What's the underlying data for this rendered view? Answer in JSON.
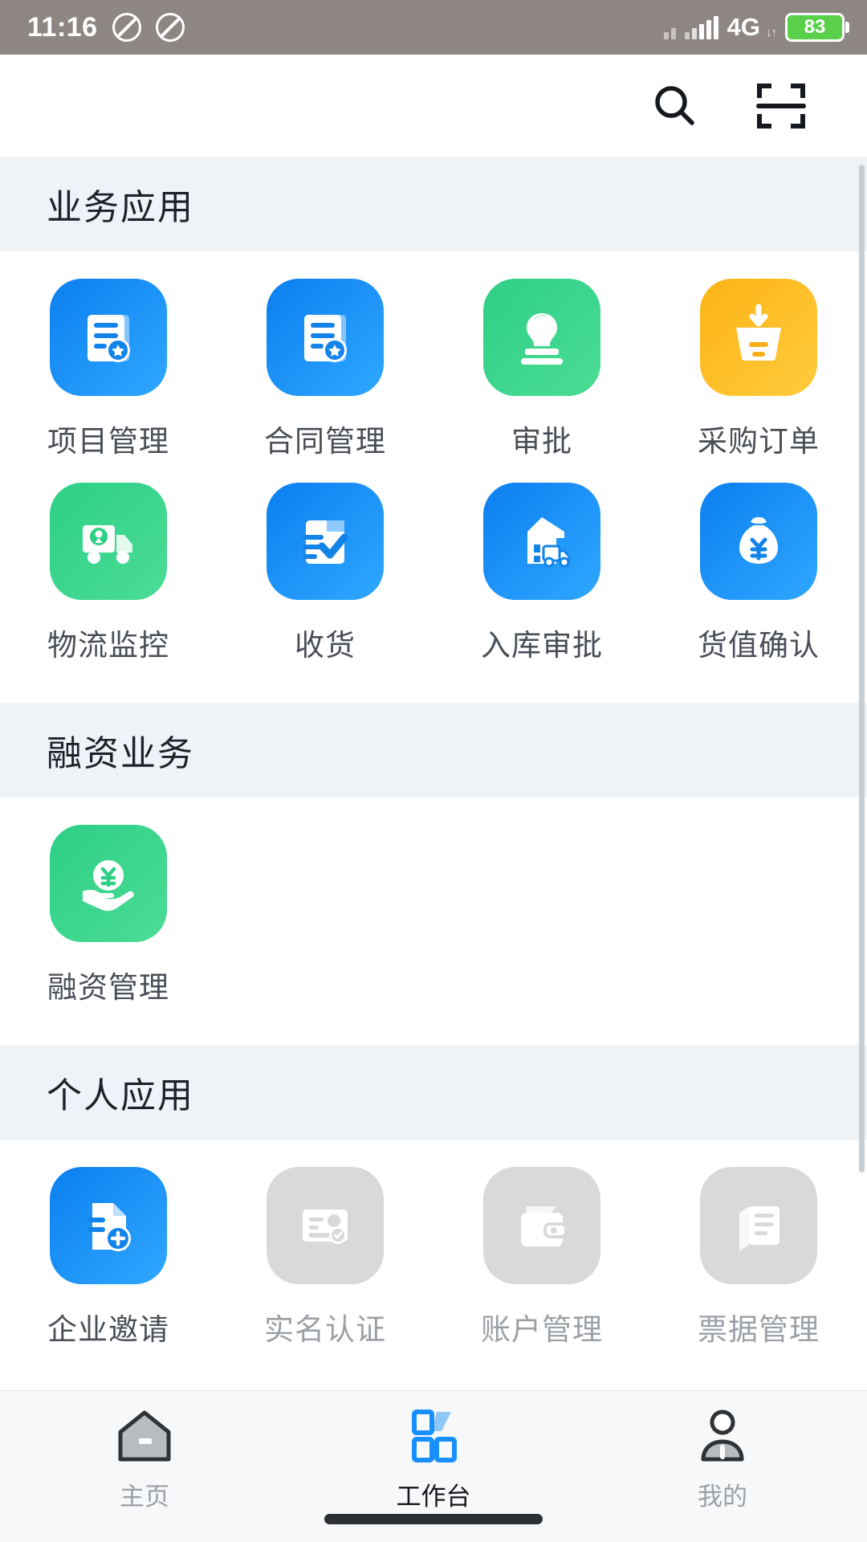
{
  "status_bar": {
    "time": "11:16",
    "network": "4G",
    "network_sub": "↓↑",
    "battery": "83",
    "icons": [
      "mute-icon",
      "mute-icon",
      "signal-bars-icon",
      "battery-icon"
    ]
  },
  "header": {
    "search_icon": "search-icon",
    "scan_icon": "scan-qr-icon"
  },
  "sections": [
    {
      "title": "业务应用",
      "items": [
        {
          "label": "项目管理",
          "icon": "document-star-icon",
          "color": "#1890ff",
          "disabled": false
        },
        {
          "label": "合同管理",
          "icon": "document-star-icon",
          "color": "#1890ff",
          "disabled": false
        },
        {
          "label": "审批",
          "icon": "stamp-icon",
          "color": "#37d186",
          "disabled": false
        },
        {
          "label": "采购订单",
          "icon": "cart-download-icon",
          "color": "#fcbb1b",
          "disabled": false
        },
        {
          "label": "物流监控",
          "icon": "truck-location-icon",
          "color": "#37d186",
          "disabled": false
        },
        {
          "label": "收货",
          "icon": "receipt-check-icon",
          "color": "#1890ff",
          "disabled": false
        },
        {
          "label": "入库审批",
          "icon": "warehouse-truck-icon",
          "color": "#1890ff",
          "disabled": false
        },
        {
          "label": "货值确认",
          "icon": "money-bag-yuan-icon",
          "color": "#1890ff",
          "disabled": false
        }
      ]
    },
    {
      "title": "融资业务",
      "items": [
        {
          "label": "融资管理",
          "icon": "hand-coin-yuan-icon",
          "color": "#37d186",
          "disabled": false
        }
      ]
    },
    {
      "title": "个人应用",
      "items": [
        {
          "label": "企业邀请",
          "icon": "document-plus-icon",
          "color": "#1890ff",
          "disabled": false
        },
        {
          "label": "实名认证",
          "icon": "id-card-icon",
          "color": "#d5d7d9",
          "disabled": true
        },
        {
          "label": "账户管理",
          "icon": "wallet-icon",
          "color": "#d5d7d9",
          "disabled": true
        },
        {
          "label": "票据管理",
          "icon": "bill-stack-icon",
          "color": "#d5d7d9",
          "disabled": true
        }
      ]
    }
  ],
  "tabbar": {
    "items": [
      {
        "label": "主页",
        "icon": "home-icon",
        "active": false
      },
      {
        "label": "工作台",
        "icon": "workbench-icon",
        "active": true
      },
      {
        "label": "我的",
        "icon": "person-icon",
        "active": false
      }
    ]
  },
  "theme": {
    "accent": "#1890ff",
    "green": "#37d186",
    "yellow": "#fcbb1b",
    "section_bg": "#eef3f8",
    "status_bg": "#8e8682",
    "disabled": "#d5d7d9"
  }
}
